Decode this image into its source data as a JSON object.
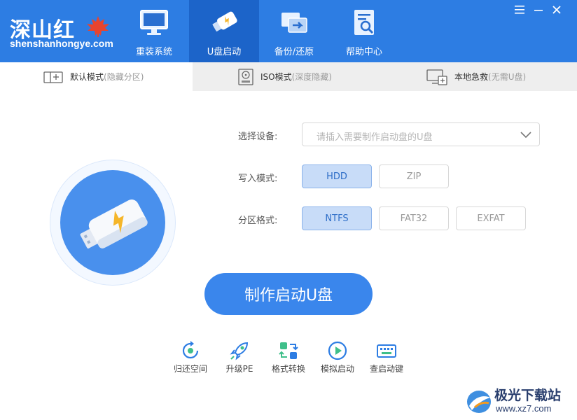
{
  "app": {
    "logo_cn": "深山红",
    "logo_en": "shenshanhongye.com"
  },
  "nav": {
    "tabs": [
      {
        "label": "重装系统",
        "icon": "monitor-icon"
      },
      {
        "label": "U盘启动",
        "icon": "usb-drive-icon",
        "active": true
      },
      {
        "label": "备份/还原",
        "icon": "backup-restore-icon"
      },
      {
        "label": "帮助中心",
        "icon": "help-document-icon"
      }
    ]
  },
  "window": {
    "menu_icon": "menu-icon",
    "minimize_icon": "minimize-icon",
    "close_icon": "close-icon"
  },
  "modes": [
    {
      "label": "默认模式",
      "sub": "(隐藏分区)",
      "icon": "partition-icon",
      "active": true
    },
    {
      "label": "ISO模式",
      "sub": "(深度隐藏)",
      "icon": "iso-disc-icon"
    },
    {
      "label": "本地急救",
      "sub": "(无需U盘)",
      "icon": "local-rescue-icon"
    }
  ],
  "form": {
    "device_label": "选择设备:",
    "device_placeholder": "请插入需要制作启动盘的U盘",
    "write_label": "写入模式:",
    "write_options": [
      "HDD",
      "ZIP"
    ],
    "write_selected": "HDD",
    "partition_label": "分区格式:",
    "partition_options": [
      "NTFS",
      "FAT32",
      "EXFAT"
    ],
    "partition_selected": "NTFS"
  },
  "action": {
    "make_label": "制作启动U盘"
  },
  "tools": [
    {
      "label": "归还空间",
      "icon": "restore-space-icon"
    },
    {
      "label": "升级PE",
      "icon": "rocket-icon"
    },
    {
      "label": "格式转换",
      "icon": "format-convert-icon"
    },
    {
      "label": "模拟启动",
      "icon": "play-icon"
    },
    {
      "label": "查启动键",
      "icon": "keyboard-icon"
    }
  ],
  "watermark": {
    "cn": "极光下载站",
    "url": "www.xz7.com"
  },
  "colors": {
    "header": "#2d7de3",
    "header_active": "#1c64c9",
    "accent": "#3a86ec",
    "selected_bg": "#c8dcf8"
  }
}
